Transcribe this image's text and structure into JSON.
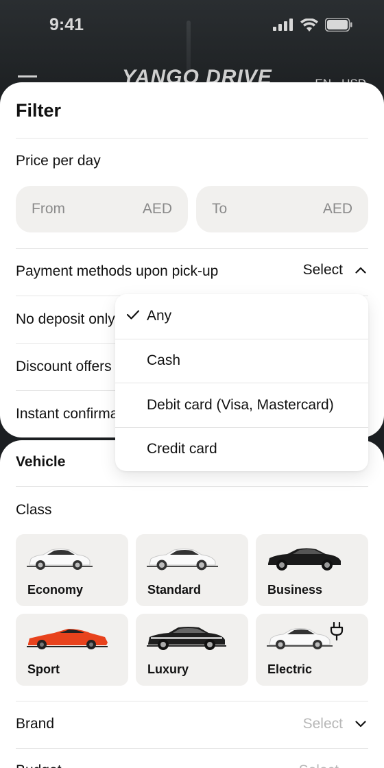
{
  "status_bar": {
    "time": "9:41"
  },
  "header": {
    "logo": "YANGO DRIVE",
    "lang_currency": "EN · USD"
  },
  "filter": {
    "title": "Filter",
    "price_label": "Price per day",
    "from_placeholder": "From",
    "to_placeholder": "To",
    "currency": "AED",
    "payment_label": "Payment methods upon pick-up",
    "payment_select": "Select",
    "no_deposit_label": "No deposit only",
    "discount_label": "Discount offers",
    "instant_label": "Instant confirmation"
  },
  "payment_dropdown": {
    "options": [
      "Any",
      "Cash",
      "Debit card (Visa, Mastercard)",
      "Credit card"
    ],
    "selected": "Any"
  },
  "vehicle": {
    "title": "Vehicle",
    "class_label": "Class",
    "classes": [
      {
        "label": "Economy",
        "color": "#ffffff"
      },
      {
        "label": "Standard",
        "color": "#ffffff"
      },
      {
        "label": "Business",
        "color": "#1a1a1a"
      },
      {
        "label": "Sport",
        "color": "#e8421c"
      },
      {
        "label": "Luxury",
        "color": "#1e1e1e"
      },
      {
        "label": "Electric",
        "color": "#ffffff"
      }
    ],
    "brand_label": "Brand",
    "brand_select": "Select",
    "next_label": "Budget",
    "next_select": "Select"
  },
  "colors": {
    "field_bg": "#f1f0ee",
    "divider": "#e6e6e6",
    "placeholder": "#8a8a8a"
  }
}
